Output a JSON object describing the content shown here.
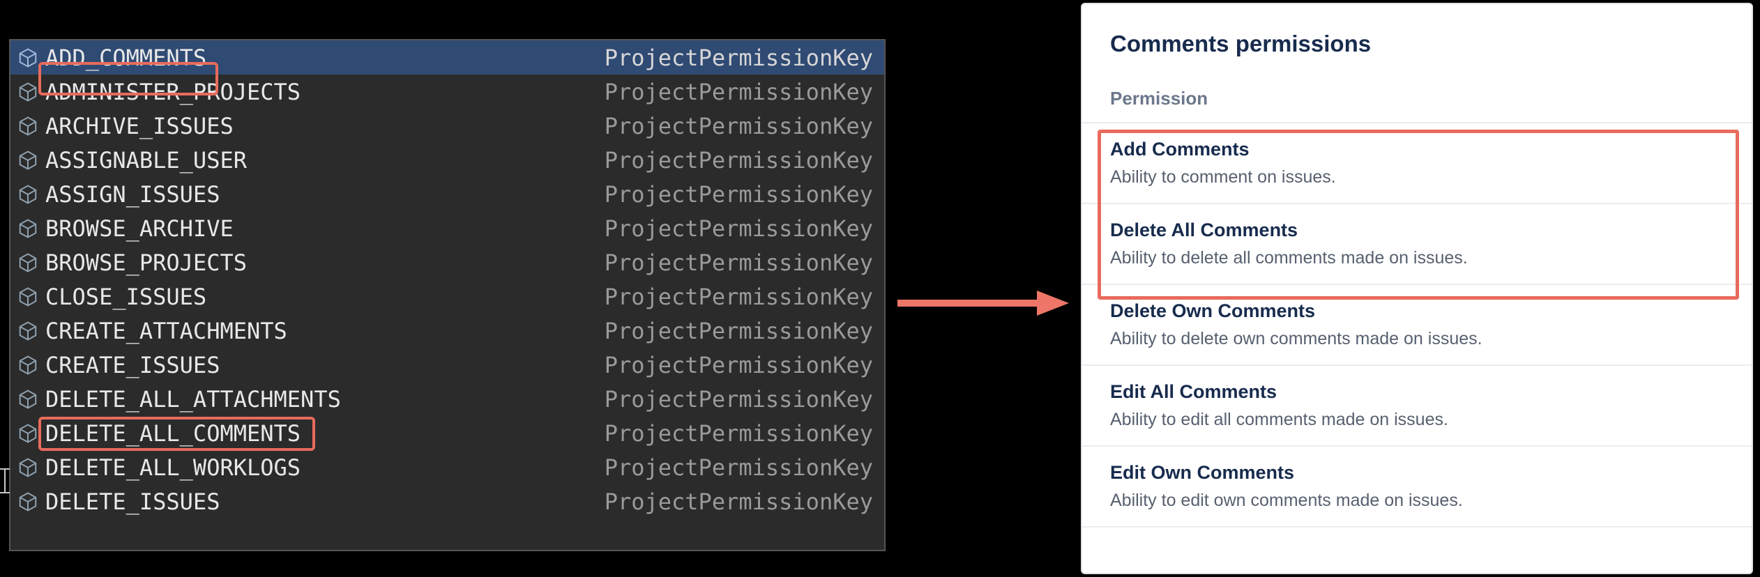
{
  "autocomplete": {
    "type_label": "ProjectPermissionKey",
    "selected_index": 0,
    "highlighted_indices": [
      0,
      11
    ],
    "items": [
      {
        "name": "ADD_COMMENTS"
      },
      {
        "name": "ADMINISTER_PROJECTS"
      },
      {
        "name": "ARCHIVE_ISSUES"
      },
      {
        "name": "ASSIGNABLE_USER"
      },
      {
        "name": "ASSIGN_ISSUES"
      },
      {
        "name": "BROWSE_ARCHIVE"
      },
      {
        "name": "BROWSE_PROJECTS"
      },
      {
        "name": "CLOSE_ISSUES"
      },
      {
        "name": "CREATE_ATTACHMENTS"
      },
      {
        "name": "CREATE_ISSUES"
      },
      {
        "name": "DELETE_ALL_ATTACHMENTS"
      },
      {
        "name": "DELETE_ALL_COMMENTS"
      },
      {
        "name": "DELETE_ALL_WORKLOGS"
      },
      {
        "name": "DELETE_ISSUES"
      }
    ]
  },
  "permissions_panel": {
    "title": "Comments permissions",
    "column_header": "Permission",
    "highlighted_range": [
      0,
      1
    ],
    "rows": [
      {
        "name": "Add Comments",
        "desc": "Ability to comment on issues."
      },
      {
        "name": "Delete All Comments",
        "desc": "Ability to delete all comments made on issues."
      },
      {
        "name": "Delete Own Comments",
        "desc": "Ability to delete own comments made on issues."
      },
      {
        "name": "Edit All Comments",
        "desc": "Ability to edit all comments made on issues."
      },
      {
        "name": "Edit Own Comments",
        "desc": "Ability to edit own comments made on issues."
      }
    ]
  },
  "colors": {
    "callout": "#e86b5c",
    "selection_bg": "#2f4a73",
    "perm_heading": "#172b4d"
  }
}
